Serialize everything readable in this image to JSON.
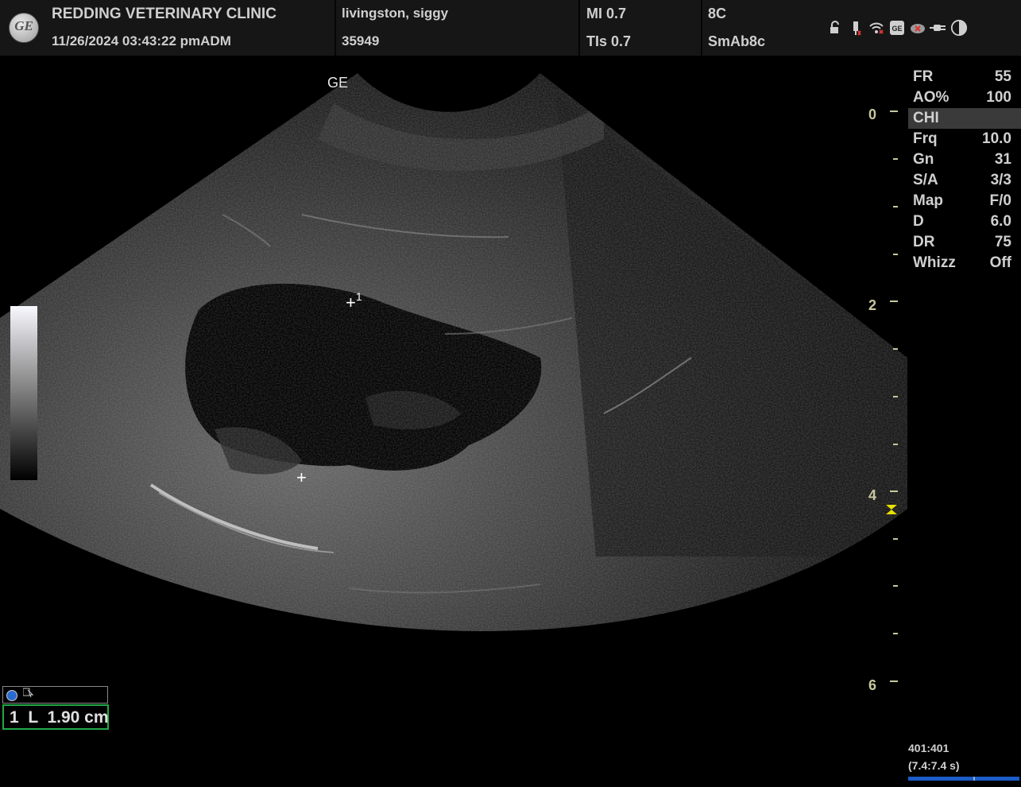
{
  "header": {
    "logo_text": "GE",
    "clinic": "REDDING VETERINARY CLINIC",
    "datetime": "11/26/2024  03:43:22 pm",
    "operator": "ADM",
    "patient_name": "livingston, siggy",
    "patient_id": "35949",
    "mi": "MI 0.7",
    "tis": "TIs 0.7",
    "probe": "8C",
    "preset": "SmAb8c",
    "status_icons": [
      "unlock-icon",
      "usb-icon",
      "wifi-icon",
      "network-icon",
      "no-connection-icon",
      "power-plug-icon",
      "contrast-icon"
    ]
  },
  "image": {
    "probe_label": "GE",
    "caliper_1_label": "1"
  },
  "params": [
    {
      "k": "FR",
      "v": "55"
    },
    {
      "k": "AO%",
      "v": "100"
    },
    {
      "k": "CHI",
      "v": ""
    },
    {
      "k": "Frq",
      "v": "10.0"
    },
    {
      "k": "Gn",
      "v": "31"
    },
    {
      "k": "S/A",
      "v": "3/3"
    },
    {
      "k": "Map",
      "v": "F/0"
    },
    {
      "k": "D",
      "v": "6.0"
    },
    {
      "k": "DR",
      "v": "75"
    },
    {
      "k": "Whizz",
      "v": "Off"
    }
  ],
  "depth_scale": {
    "labels": [
      "0",
      "2",
      "4",
      "6"
    ],
    "max_cm": 6.0
  },
  "measurement": {
    "value": "1  L  1.90 cm"
  },
  "cine": {
    "frames": "401:401",
    "time": "(7.4:7.4 s)"
  },
  "colors": {
    "header_bg": "#161616",
    "measure_border": "#22a847",
    "depth_scale": "#c8c8a0",
    "cine_bar": "#1a5cc8",
    "focus_marker": "#e8e000"
  }
}
